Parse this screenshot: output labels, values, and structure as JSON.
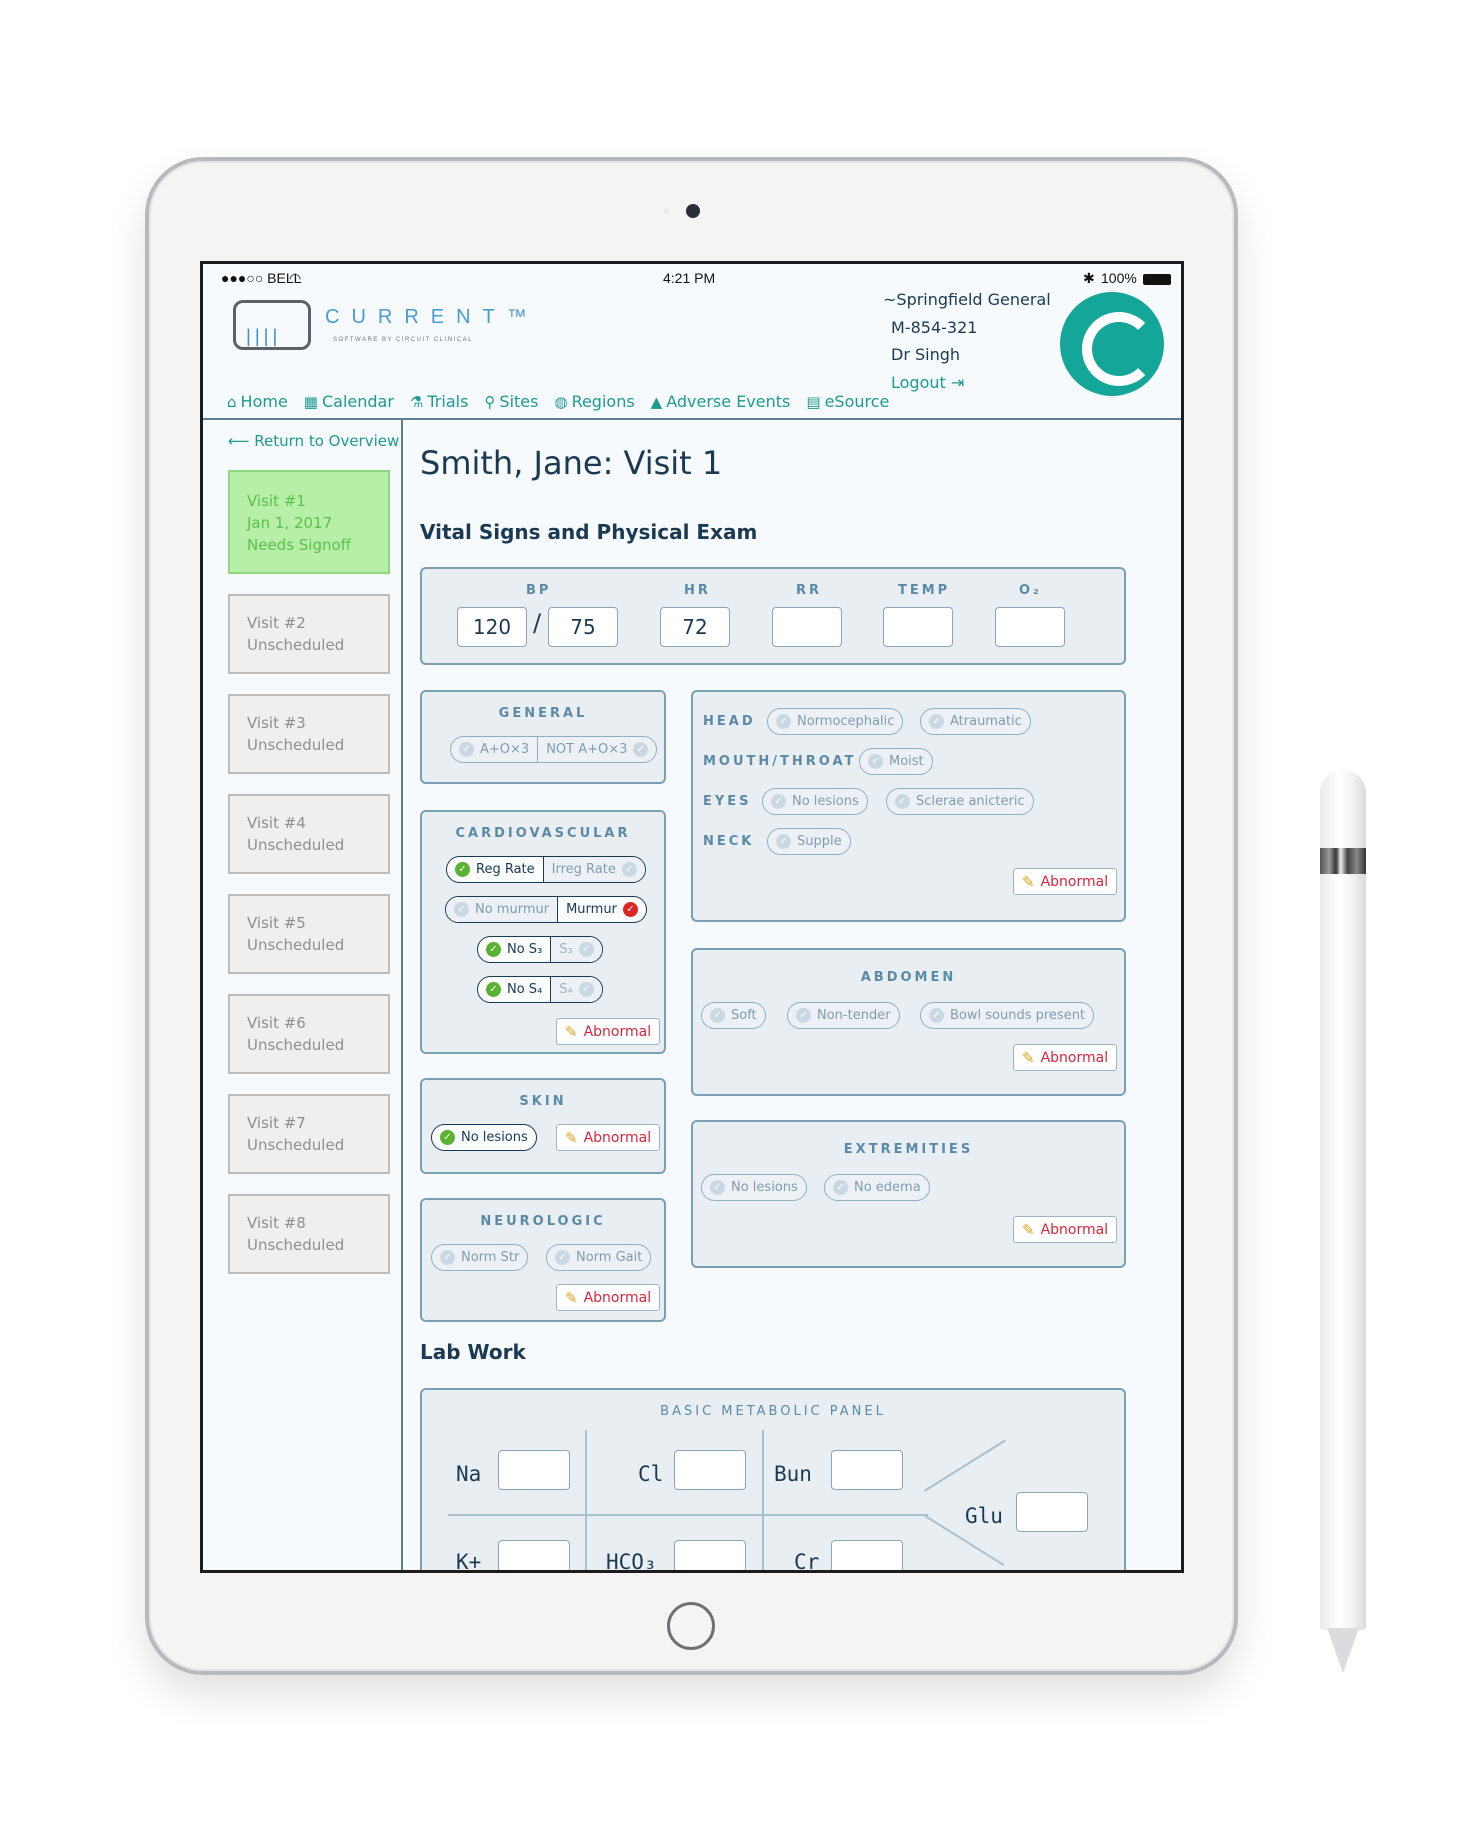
{
  "status_bar": {
    "carrier": "●●●○○ BELL",
    "time": "4:21 PM",
    "battery": "100%"
  },
  "app": {
    "logo_word": "CURRENT™",
    "logo_sub": "SOFTWARE BY CIRCUIT CLINICAL"
  },
  "nav": [
    {
      "label": "Home",
      "icon": "home-icon",
      "glyph": "⌂"
    },
    {
      "label": "Calendar",
      "icon": "calendar-icon",
      "glyph": "▦"
    },
    {
      "label": "Trials",
      "icon": "microscope-icon",
      "glyph": "⚗"
    },
    {
      "label": "Sites",
      "icon": "map-pin-icon",
      "glyph": "⚲"
    },
    {
      "label": "Regions",
      "icon": "globe-icon",
      "glyph": "◍"
    },
    {
      "label": "Adverse Events",
      "icon": "warning-icon",
      "glyph": "▲"
    },
    {
      "label": "eSource",
      "icon": "inbox-icon",
      "glyph": "▤"
    }
  ],
  "user": {
    "site": "~Springfield General",
    "id": "M-854-321",
    "doctor": "Dr Singh",
    "logout": "Logout ⇥",
    "accent": "#14a699"
  },
  "sidebar": {
    "return_label": "⟵ Return to Overview",
    "visits": [
      {
        "title": "Visit #1",
        "date": "Jan 1, 2017",
        "status": "Needs Signoff",
        "active": true
      },
      {
        "title": "Visit #2",
        "status": "Unscheduled"
      },
      {
        "title": "Visit #3",
        "status": "Unscheduled"
      },
      {
        "title": "Visit #4",
        "status": "Unscheduled"
      },
      {
        "title": "Visit #5",
        "status": "Unscheduled"
      },
      {
        "title": "Visit #6",
        "status": "Unscheduled"
      },
      {
        "title": "Visit #7",
        "status": "Unscheduled"
      },
      {
        "title": "Visit #8",
        "status": "Unscheduled"
      }
    ]
  },
  "main": {
    "title": "Smith, Jane: Visit 1",
    "vitals_heading": "Vital Signs and Physical Exam",
    "vitals": {
      "bp_label": "BP",
      "bp_sys": "120",
      "bp_sep": "/",
      "bp_dia": "75",
      "hr_label": "HR",
      "hr": "72",
      "rr_label": "RR",
      "rr": "",
      "temp_label": "TEMP",
      "temp": "",
      "o2_label": "O₂",
      "o2": ""
    },
    "general": {
      "label": "GENERAL",
      "options": [
        "A+O×3",
        "NOT A+O×3"
      ]
    },
    "cardio": {
      "label": "CARDIOVASCULAR",
      "rows": [
        {
          "a": "Reg Rate",
          "b": "Irreg Rate",
          "selected": "a"
        },
        {
          "a": "No murmur",
          "b": "Murmur",
          "selected": "b"
        },
        {
          "a": "No S₃",
          "b": "S₃",
          "selected": "a"
        },
        {
          "a": "No S₄",
          "b": "S₄",
          "selected": "a"
        }
      ],
      "abnormal": "Abnormal"
    },
    "skin": {
      "label": "SKIN",
      "option": "No lesions",
      "selected": true,
      "abnormal": "Abnormal"
    },
    "neuro": {
      "label": "NEUROLOGIC",
      "options": [
        "Norm Str",
        "Norm Gait"
      ],
      "abnormal": "Abnormal"
    },
    "heent": {
      "rows": [
        {
          "label": "HEAD",
          "options": [
            "Normocephalic",
            "Atraumatic"
          ]
        },
        {
          "label": "MOUTH/THROAT",
          "options": [
            "Moist"
          ]
        },
        {
          "label": "EYES",
          "options": [
            "No lesions",
            "Sclerae anicteric"
          ]
        },
        {
          "label": "NECK",
          "options": [
            "Supple"
          ]
        }
      ],
      "abnormal": "Abnormal"
    },
    "abdomen": {
      "label": "ABDOMEN",
      "options": [
        "Soft",
        "Non-tender",
        "Bowl sounds present"
      ],
      "abnormal": "Abnormal"
    },
    "extremities": {
      "label": "EXTREMITIES",
      "options": [
        "No lesions",
        "No edema"
      ],
      "abnormal": "Abnormal"
    },
    "lab_heading": "Lab Work",
    "bmp": {
      "label": "BASIC METABOLIC PANEL",
      "fields": {
        "na": "Na",
        "cl": "Cl",
        "bun": "Bun",
        "glu": "Glu",
        "k": "K+",
        "hco3": "HCO₃",
        "cr": "Cr"
      }
    }
  }
}
